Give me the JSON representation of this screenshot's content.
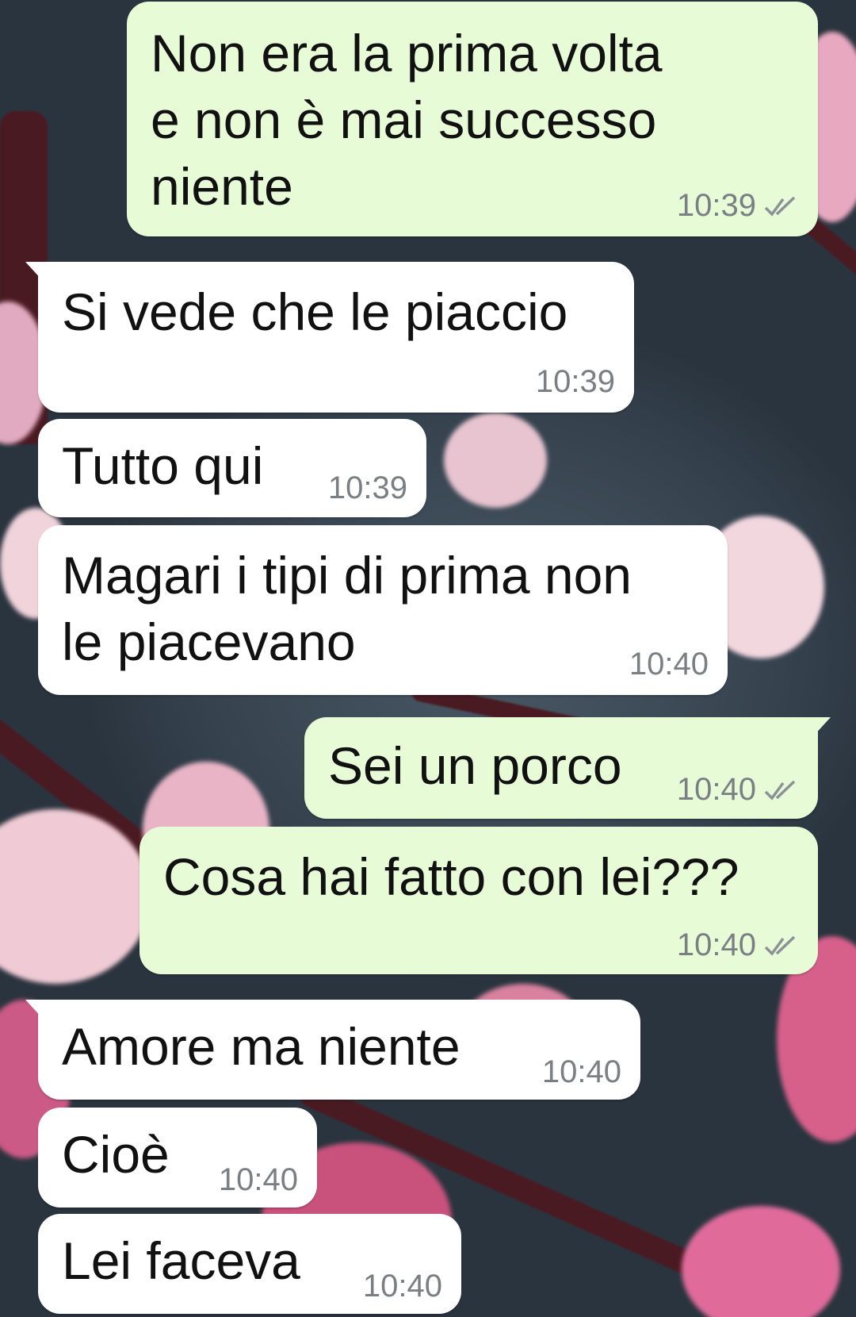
{
  "colors": {
    "outgoing_bubble": "#e7fbd7",
    "incoming_bubble": "#ffffff",
    "timestamp": "#7a7f84",
    "read_ticks": "#8c9197"
  },
  "messages": [
    {
      "id": "m1",
      "direction": "out",
      "lines": [
        "Non era la prima volta",
        "e non è mai successo",
        "niente"
      ],
      "time": "10:39",
      "status_icon": "double-check-icon"
    },
    {
      "id": "m2",
      "direction": "in",
      "lines": [
        "Si vede che le piaccio"
      ],
      "time": "10:39"
    },
    {
      "id": "m3",
      "direction": "in",
      "lines": [
        "Tutto qui"
      ],
      "time": "10:39"
    },
    {
      "id": "m4",
      "direction": "in",
      "lines": [
        "Magari i tipi di prima non",
        "le piacevano"
      ],
      "time": "10:40"
    },
    {
      "id": "m5",
      "direction": "out",
      "lines": [
        "Sei un porco"
      ],
      "time": "10:40",
      "status_icon": "double-check-icon"
    },
    {
      "id": "m6",
      "direction": "out",
      "lines": [
        "Cosa hai fatto con lei???"
      ],
      "time": "10:40",
      "status_icon": "double-check-icon"
    },
    {
      "id": "m7",
      "direction": "in",
      "lines": [
        "Amore ma niente"
      ],
      "time": "10:40"
    },
    {
      "id": "m8",
      "direction": "in",
      "lines": [
        "Cioè"
      ],
      "time": "10:40"
    },
    {
      "id": "m9",
      "direction": "in",
      "lines": [
        "Lei faceva"
      ],
      "time": "10:40"
    }
  ]
}
